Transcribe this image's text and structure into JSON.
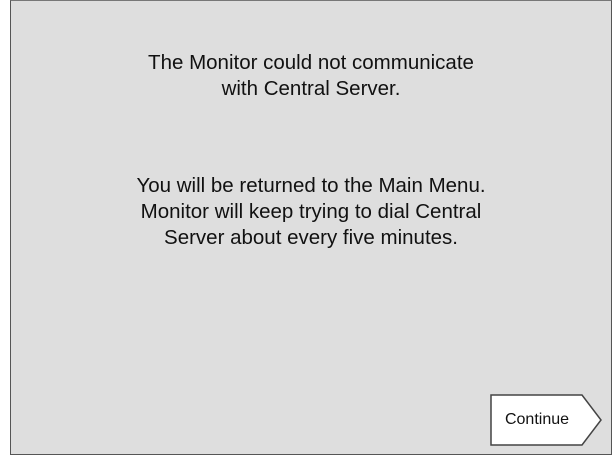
{
  "message": {
    "line1": "The Monitor could not communicate",
    "line2": "with Central Server.",
    "line3": "You will be returned to the Main Menu.",
    "line4": "Monitor will keep trying to dial Central",
    "line5": "Server about every five minutes."
  },
  "continue_button": {
    "label": "Continue"
  }
}
